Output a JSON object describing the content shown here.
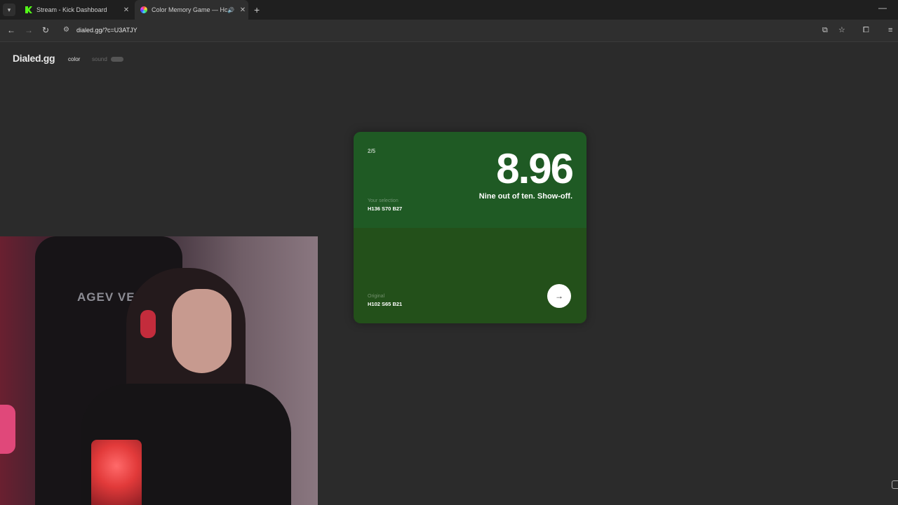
{
  "browser": {
    "tabs": [
      {
        "title": "Stream - Kick Dashboard",
        "favicon": "kick-icon",
        "active": false
      },
      {
        "title": "Color Memory Game — Ho",
        "favicon": "color-wheel-icon",
        "active": true,
        "audio": true
      }
    ],
    "url": "dialed.gg/?c=U3ATJY"
  },
  "page": {
    "logo": "Dialed.gg",
    "modes": {
      "color": "color",
      "sound": "sound"
    }
  },
  "card": {
    "round": "2/5",
    "score": "8.96",
    "quip": "Nine out of ten. Show-off.",
    "selection_label": "Your selection",
    "selection_value": "H136 S70 B27",
    "original_label": "Original",
    "original_value": "H102 S65 B21",
    "selection_color": "#1f5a24",
    "original_color": "#23501a"
  },
  "webcam": {
    "chair_logo": "AGEV VEGA"
  }
}
